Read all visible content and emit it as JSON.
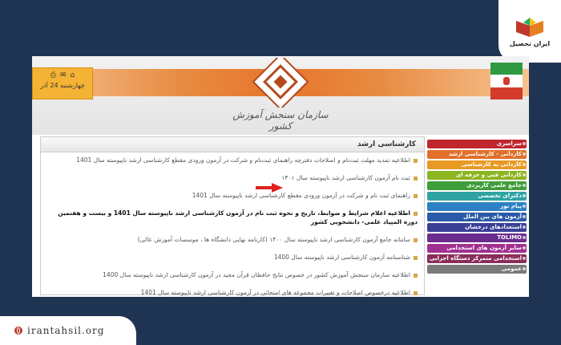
{
  "brand": {
    "name": "ایران تحصیل",
    "url": "irantahsil.org"
  },
  "site": {
    "date_text": "چهارشنبه 24 آذر",
    "org_name": "سازمان سنجش آموزش کشور",
    "panel_title": "کارشناسی ارشد"
  },
  "news": [
    {
      "text": "اطلاعیه تمدید مهلت ثبت‌نام و اصلاحات دفترچه راهنمای ثبت‌نام و شرکت در آزمون ورودی مقطع کارشناسی ارشد ناپیوسته سال 1401",
      "bold": false
    },
    {
      "text": "ثبت نام آزمون کارشناسی ارشد ناپیوسته سال ۱۴۰۱",
      "bold": false
    },
    {
      "text": "راهنمای ثبت نام و شرکت در آزمون ورودی مقطع کارشناسی ارشد ناپیوسته سال 1401",
      "bold": false
    },
    {
      "text": "اطلاعیه اعلام شرایط و ضوابط، تاریخ و نحوه ثبت نام در آزمون کارشناسی ارشد ناپیوسته سال 1401 و بیست و هفتمین دوره المپیاد علمی- دانشجویی کشور",
      "bold": true
    },
    {
      "text": "سامانه جامع آزمون کارشناسی ارشد ناپیوسته سال ۱۴۰۰ (کارنامه نهایی دانشگاه ها ، موسسات آموزش عالی)",
      "bold": false
    },
    {
      "text": "شناسنامه آزمون کارشناسی ارشد ناپیوسته سال 1400",
      "bold": false
    },
    {
      "text": "اطلاعیه سازمان سنجش آموزش کشور در خصوص نتایج حافظان قرآن مجید در آزمون کارشناسی ارشد ناپیوسته سال 1400",
      "bold": false
    },
    {
      "text": "اطلاعیه درخصوص اصلاحات و تغییرات مجموعه های امتحانی در آزمون کارشناسی ارشد ناپیوسته سال 1401",
      "bold": false
    }
  ],
  "menu": [
    {
      "label": "سراسری",
      "color": "#c0262e"
    },
    {
      "label": "کاردانی - کارشناسی ارشد",
      "color": "#e0702a"
    },
    {
      "label": "کاردانی به کارشناسی",
      "color": "#e89a25"
    },
    {
      "label": "کاردانی فنی و حرفه ای",
      "color": "#8cb51f"
    },
    {
      "label": "جامع علمی کاربردی",
      "color": "#3f9e3a"
    },
    {
      "label": "دکترای تخصصی",
      "color": "#2fa3a3"
    },
    {
      "label": "پیام نور",
      "color": "#2d80c4"
    },
    {
      "label": "آزمون های بین الملل",
      "color": "#2a5aa8"
    },
    {
      "label": "استعدادهای درخشان",
      "color": "#3a3f96"
    },
    {
      "label": "TOLIMO",
      "color": "#6a2d8f"
    },
    {
      "label": "سایر آزمون های استخدامی",
      "color": "#a03090"
    },
    {
      "label": "استخدامی متمرکز دستگاه اجرایی",
      "color": "#8a2d5a"
    },
    {
      "label": "عمومی",
      "color": "#7a7a7a"
    }
  ]
}
